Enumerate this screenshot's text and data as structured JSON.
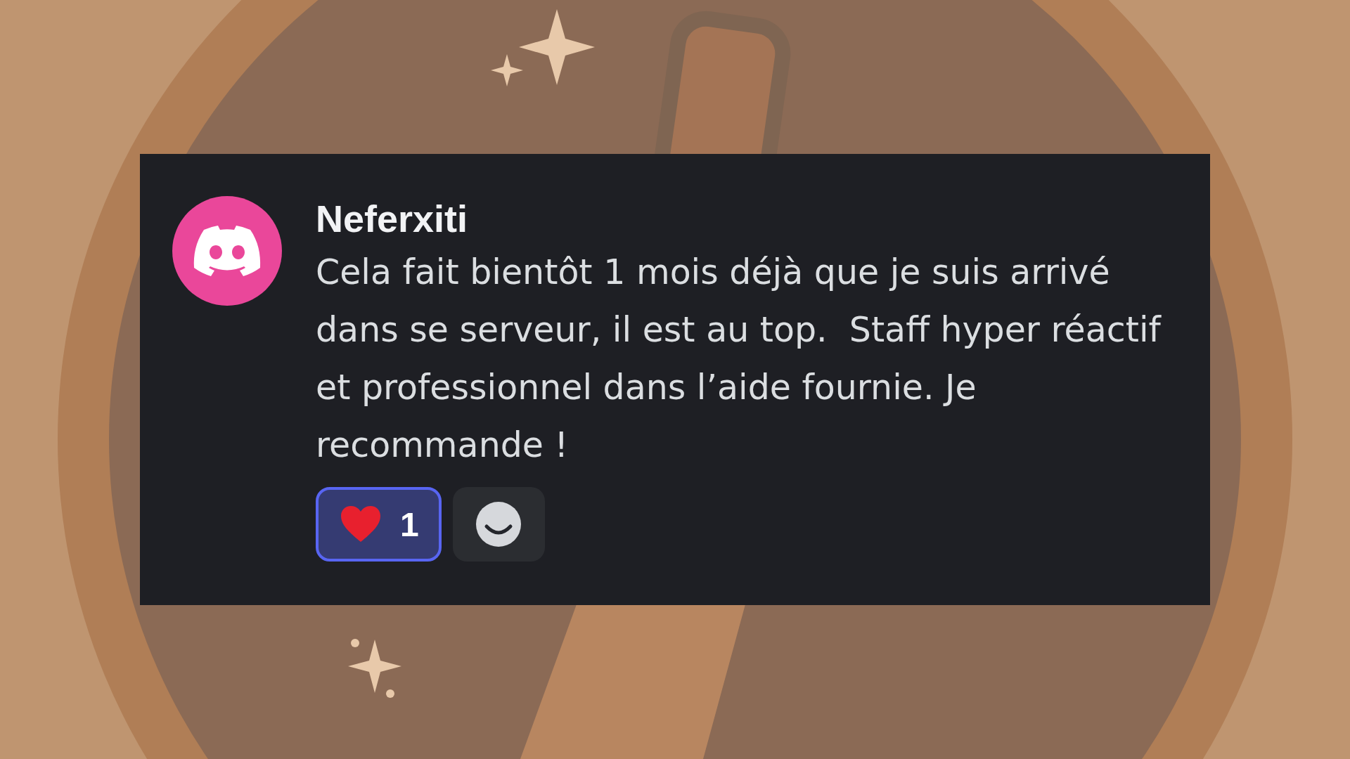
{
  "message": {
    "author": "Neferxiti",
    "text": "Cela fait bientôt 1 mois déjà que je suis arrivé dans se serveur, il est au top.  Staff hyper réactif et professionnel dans l’aide fournie. Je recommande !",
    "reactions": [
      {
        "count": "1",
        "selected": true
      }
    ]
  }
}
